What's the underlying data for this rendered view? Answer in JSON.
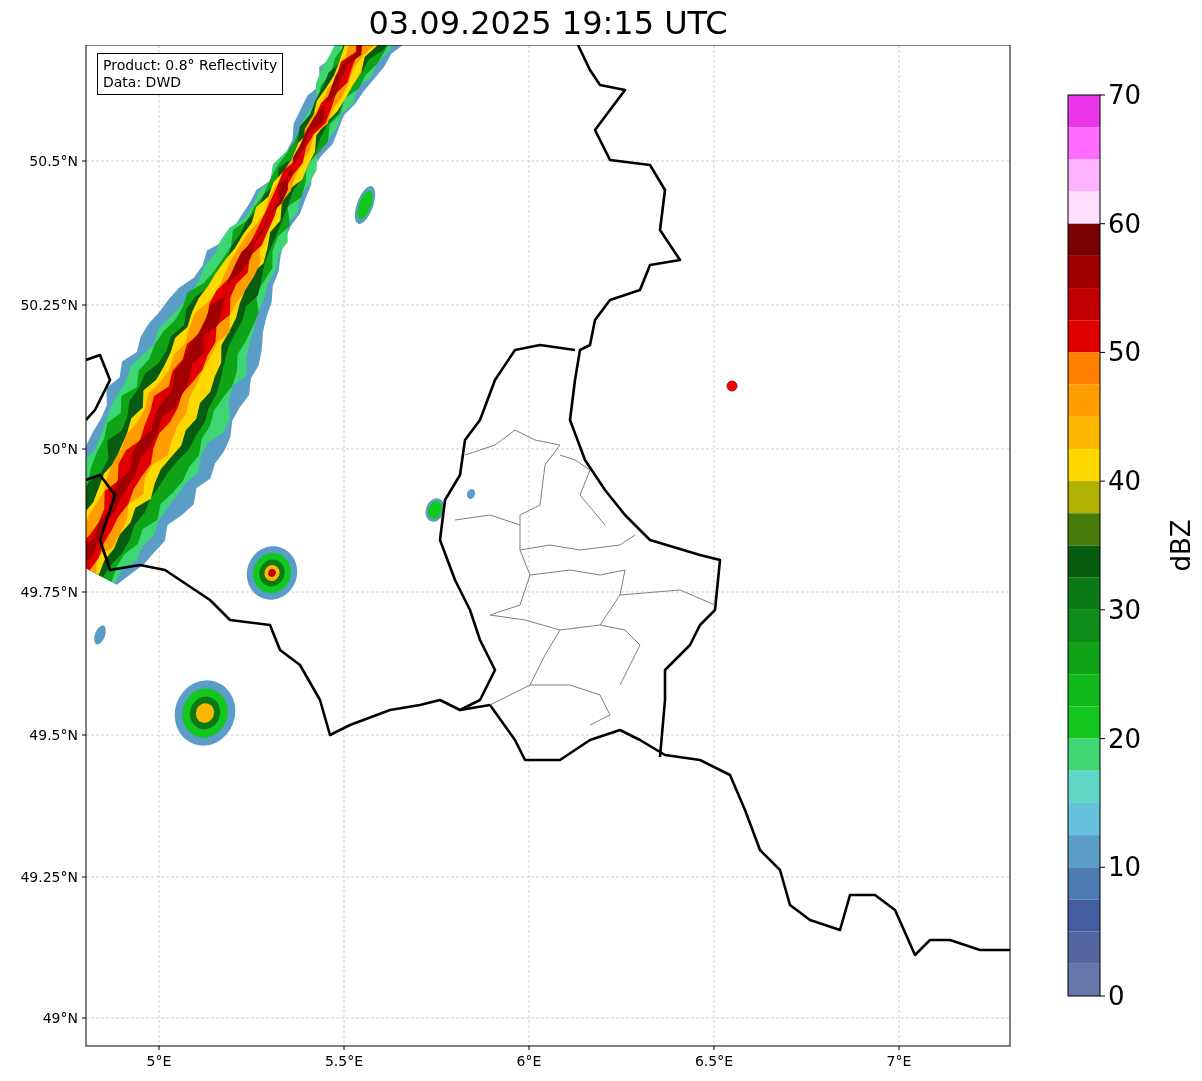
{
  "title": "03.09.2025 19:15 UTC",
  "info_box": {
    "lines": [
      "Product: 0.8° Reflectivity",
      "Data: DWD"
    ]
  },
  "map": {
    "x_labels": [
      "5°E",
      "5.5°E",
      "6°E",
      "6.5°E",
      "7°E"
    ],
    "y_labels": [
      "50.5°N",
      "50.25°N",
      "50°N",
      "49.75°N",
      "49.5°N",
      "49.25°N",
      "49°N"
    ]
  },
  "colorbar": {
    "label": "dBZ",
    "tick_labels": [
      "70",
      "60",
      "50",
      "40",
      "30",
      "20",
      "10",
      "0"
    ],
    "bands": [
      {
        "color": "#ec36ec"
      },
      {
        "color": "#ff6bff"
      },
      {
        "color": "#ffb3ff"
      },
      {
        "color": "#ffe0ff"
      },
      {
        "color": "#780000"
      },
      {
        "color": "#a00000"
      },
      {
        "color": "#c00000"
      },
      {
        "color": "#e00000"
      },
      {
        "color": "#ff8000"
      },
      {
        "color": "#ff9d00"
      },
      {
        "color": "#ffb800"
      },
      {
        "color": "#ffd800"
      },
      {
        "color": "#b1b104"
      },
      {
        "color": "#467b0c"
      },
      {
        "color": "#075d0f"
      },
      {
        "color": "#0c7a14"
      },
      {
        "color": "#0d8c17"
      },
      {
        "color": "#0fa318"
      },
      {
        "color": "#11b81b"
      },
      {
        "color": "#12c71e"
      },
      {
        "color": "#3ed673"
      },
      {
        "color": "#60d7c6"
      },
      {
        "color": "#66c1dc"
      },
      {
        "color": "#5a9dc7"
      },
      {
        "color": "#4d7bb3"
      },
      {
        "color": "#435ea0"
      },
      {
        "color": "#5466a0"
      },
      {
        "color": "#6577a8"
      }
    ]
  }
}
